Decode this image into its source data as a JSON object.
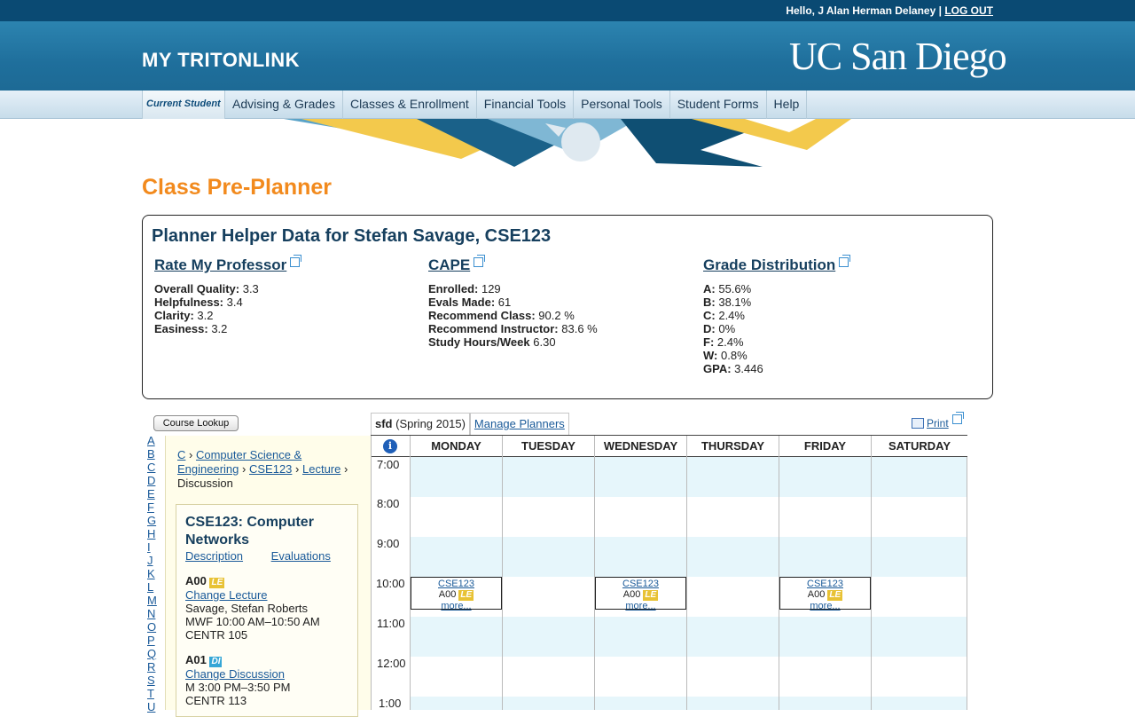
{
  "topbar": {
    "hello": "Hello,",
    "user": "J Alan Herman Delaney",
    "separator": "|",
    "logout": "LOG OUT"
  },
  "header": {
    "site_title": "MY TRITONLINK",
    "logo": "UC San Diego"
  },
  "nav": {
    "current": "Current Student",
    "items": [
      "Advising & Grades",
      "Classes & Enrollment",
      "Financial Tools",
      "Personal Tools",
      "Student Forms",
      "Help"
    ]
  },
  "page_title": "Class Pre-Planner",
  "helper": {
    "title": "Planner Helper Data for Stefan Savage, CSE123",
    "rmp": {
      "title": "Rate My Professor",
      "rows": [
        {
          "label": "Overall Quality:",
          "value": "3.3"
        },
        {
          "label": "Helpfulness:",
          "value": "3.4"
        },
        {
          "label": "Clarity:",
          "value": "3.2"
        },
        {
          "label": "Easiness:",
          "value": "3.2"
        }
      ]
    },
    "cape": {
      "title": "CAPE",
      "rows": [
        {
          "label": "Enrolled:",
          "value": "129"
        },
        {
          "label": "Evals Made:",
          "value": "61"
        },
        {
          "label": "Recommend Class:",
          "value": "90.2 %"
        },
        {
          "label": "Recommend Instructor:",
          "value": "83.6 %"
        },
        {
          "label": "Study Hours/Week",
          "value": "6.30"
        }
      ]
    },
    "grades": {
      "title": "Grade Distribution",
      "rows": [
        {
          "label": "A:",
          "value": "55.6%"
        },
        {
          "label": "B:",
          "value": "38.1%"
        },
        {
          "label": "C:",
          "value": "2.4%"
        },
        {
          "label": "D:",
          "value": "0%"
        },
        {
          "label": "F:",
          "value": "2.4%"
        },
        {
          "label": "W:",
          "value": "0.8%"
        },
        {
          "label": "GPA:",
          "value": "3.446"
        }
      ]
    }
  },
  "lookup_button": "Course Lookup",
  "alphabet": [
    "A",
    "B",
    "C",
    "D",
    "E",
    "F",
    "G",
    "H",
    "I",
    "J",
    "K",
    "L",
    "M",
    "N",
    "O",
    "P",
    "Q",
    "R",
    "S",
    "T",
    "U"
  ],
  "breadcrumb": {
    "c": "C",
    "dept": "Computer Science & Engineering",
    "course": "CSE123",
    "lecture": "Lecture",
    "current": "Discussion",
    "sep": "›"
  },
  "course": {
    "title": "CSE123: Computer Networks",
    "description": "Description",
    "evaluations": "Evaluations",
    "sections": [
      {
        "code": "A00",
        "tag": "LE",
        "action": "Change Lecture",
        "instructor": "Savage, Stefan Roberts",
        "time": "MWF 10:00 AM–10:50 AM",
        "room": "CENTR 105"
      },
      {
        "code": "A01",
        "tag": "DI",
        "action": "Change Discussion",
        "time": "M 3:00 PM–3:50 PM",
        "room": "CENTR 113"
      }
    ]
  },
  "planner": {
    "name": "sfd",
    "term": "(Spring 2015)",
    "manage": "Manage Planners",
    "print": "Print"
  },
  "calendar": {
    "days": [
      "MONDAY",
      "TUESDAY",
      "WEDNESDAY",
      "THURSDAY",
      "FRIDAY",
      "SATURDAY"
    ],
    "times": [
      "7:00",
      "8:00",
      "9:00",
      "10:00",
      "11:00",
      "12:00",
      "1:00"
    ],
    "event": {
      "course": "CSE123",
      "section": "A00",
      "tag": "LE",
      "more": "more...",
      "days": [
        "MONDAY",
        "WEDNESDAY",
        "FRIDAY"
      ]
    }
  }
}
